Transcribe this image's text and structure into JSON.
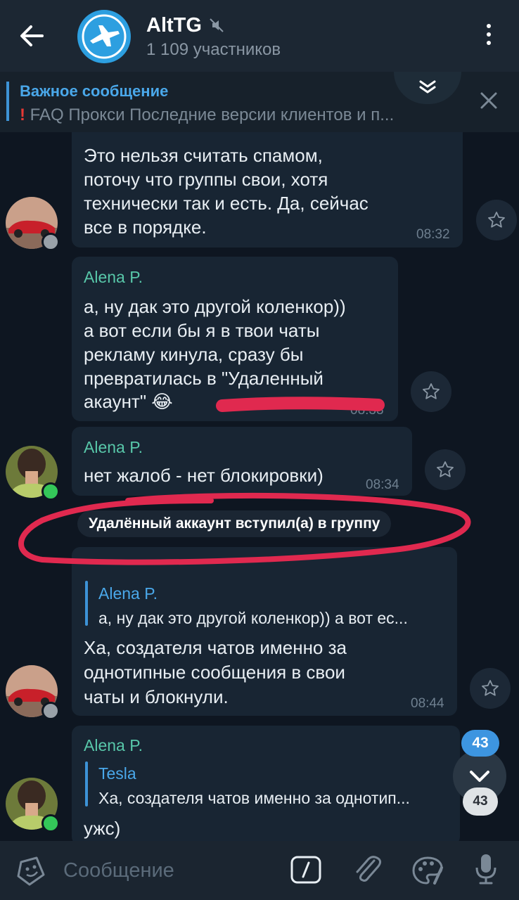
{
  "header": {
    "title": "AltTG",
    "subtitle": "1 109 участников"
  },
  "pinned": {
    "title": "Важное сообщение",
    "text": "FAQ  Прокси  Последние версии клиентов и п..."
  },
  "messages": {
    "m1": {
      "lines": [
        "Это нельзя считать спамом,",
        "поточу что  группы свои, хотя",
        "технически так и есть.  Да, сейчас",
        "все в порядке."
      ],
      "time": "08:32"
    },
    "m2": {
      "sender": "Alena P.",
      "lines": [
        "а, ну дак это другой коленкор))",
        "а вот если бы я в твои чаты",
        "рекламу кинула, сразу бы",
        "превратилась в \"Удаленный",
        "акаунт\" 😂"
      ],
      "time": "08:33"
    },
    "m3": {
      "sender": "Alena P.",
      "text": "нет жалоб - нет блокировки)",
      "time": "08:34"
    },
    "service": "Удалённый аккаунт вступил(а) в группу",
    "m4": {
      "reply_name": "Alena P.",
      "reply_text": "а, ну дак это другой коленкор)) а вот ес...",
      "lines": [
        "Ха, создателя чатов именно за",
        "однотипные сообщения в свои",
        "чаты и блокнули."
      ],
      "time": "08:44"
    },
    "m5": {
      "sender": "Alena P.",
      "reply_name": "Tesla",
      "reply_text": "Ха, создателя чатов именно за однотип...",
      "text": "ужс)"
    }
  },
  "badges": {
    "unread_top": "43",
    "unread_bottom": "43"
  },
  "input": {
    "placeholder": "Сообщение"
  },
  "colors": {
    "accent": "#3d93d6",
    "sender": "#58c7a9",
    "annotation": "#e0294f"
  },
  "icons": [
    "back-arrow-icon",
    "mute-icon",
    "more-vert-icon",
    "expand-icon",
    "close-icon",
    "star-icon",
    "chevron-down-icon",
    "sticker-icon",
    "slash-command-icon",
    "attach-icon",
    "palette-icon",
    "mic-icon"
  ]
}
